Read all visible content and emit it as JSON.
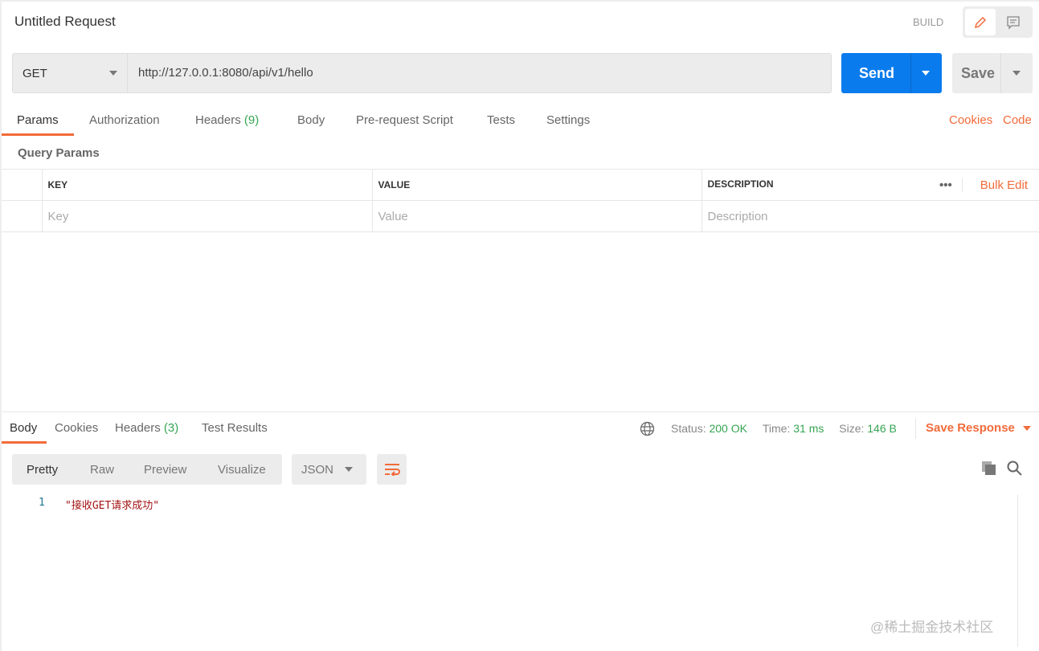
{
  "header": {
    "title": "Untitled Request",
    "mode_label": "BUILD"
  },
  "request": {
    "method": "GET",
    "url": "http://127.0.0.1:8080/api/v1/hello",
    "send_label": "Send",
    "save_label": "Save"
  },
  "req_tabs": [
    {
      "label": "Params"
    },
    {
      "label": "Authorization"
    },
    {
      "label": "Headers",
      "count": "(9)"
    },
    {
      "label": "Body"
    },
    {
      "label": "Pre-request Script"
    },
    {
      "label": "Tests"
    },
    {
      "label": "Settings"
    }
  ],
  "req_links": {
    "cookies": "Cookies",
    "code": "Code"
  },
  "params": {
    "title": "Query Params",
    "columns": [
      "KEY",
      "VALUE",
      "DESCRIPTION"
    ],
    "bulk_edit": "Bulk Edit",
    "placeholders": [
      "Key",
      "Value",
      "Description"
    ]
  },
  "resp_tabs": [
    {
      "label": "Body"
    },
    {
      "label": "Cookies"
    },
    {
      "label": "Headers",
      "count": "(3)"
    },
    {
      "label": "Test Results"
    }
  ],
  "status": {
    "status_label": "Status:",
    "status": "200 OK",
    "time_label": "Time:",
    "time": "31 ms",
    "size_label": "Size:",
    "size": "146 B",
    "save_response": "Save Response"
  },
  "view": {
    "modes": [
      "Pretty",
      "Raw",
      "Preview",
      "Visualize"
    ],
    "format": "JSON"
  },
  "body": {
    "line_number": "1",
    "content": "\"接收GET请求成功\""
  },
  "watermark": "@稀土掘金技术社区",
  "colors": {
    "accent": "#f26b3a",
    "primary": "#097bed",
    "success": "#36a552"
  }
}
